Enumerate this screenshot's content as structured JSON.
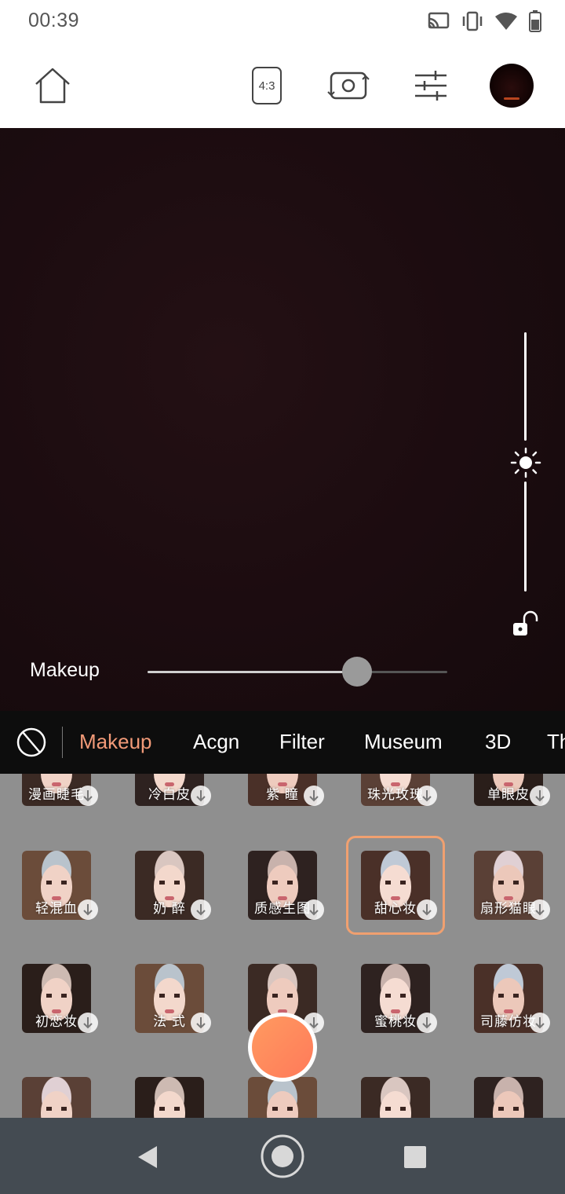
{
  "status_bar": {
    "time": "00:39",
    "icons": [
      "cast-icon",
      "vibrate-icon",
      "wifi-icon",
      "battery-icon"
    ]
  },
  "toolbar": {
    "home_icon": "home-icon",
    "aspect_ratio": "4:3",
    "flip_camera_icon": "flip-camera-icon",
    "settings_icon": "sliders-icon",
    "gallery_icon": "gallery-thumbnail"
  },
  "camera": {
    "exposure_icon": "sun-icon",
    "lock_icon": "unlock-icon",
    "intensity_label": "Makeup",
    "intensity_value": 0.7
  },
  "tabs": {
    "none_icon": "no-effect-icon",
    "items": [
      "Makeup",
      "Acgn",
      "Filter",
      "Museum",
      "3D",
      "Th"
    ],
    "active": "Makeup"
  },
  "makeup_grid": {
    "rows": [
      [
        "漫画睫毛",
        "冷白皮",
        "紫 瞳",
        "珠光玫瑰",
        "单眼皮"
      ],
      [
        "轻混血",
        "奶 醉",
        "质感生图",
        "甜心妆",
        "扇形猫眼"
      ],
      [
        "初恋妆",
        "法 式",
        "",
        "蜜桃妆",
        "司藤仿妆"
      ],
      [
        "",
        "",
        "",
        "",
        ""
      ]
    ],
    "selected": "甜心妆"
  },
  "shutter": {
    "icon": "shutter-button"
  },
  "nav": {
    "back_icon": "back-icon",
    "home_icon": "home-circle-icon",
    "recents_icon": "recents-icon"
  },
  "colors": {
    "accent": "#f29a78",
    "shutter": "#ff8a5c",
    "selection": "#f0a070"
  }
}
